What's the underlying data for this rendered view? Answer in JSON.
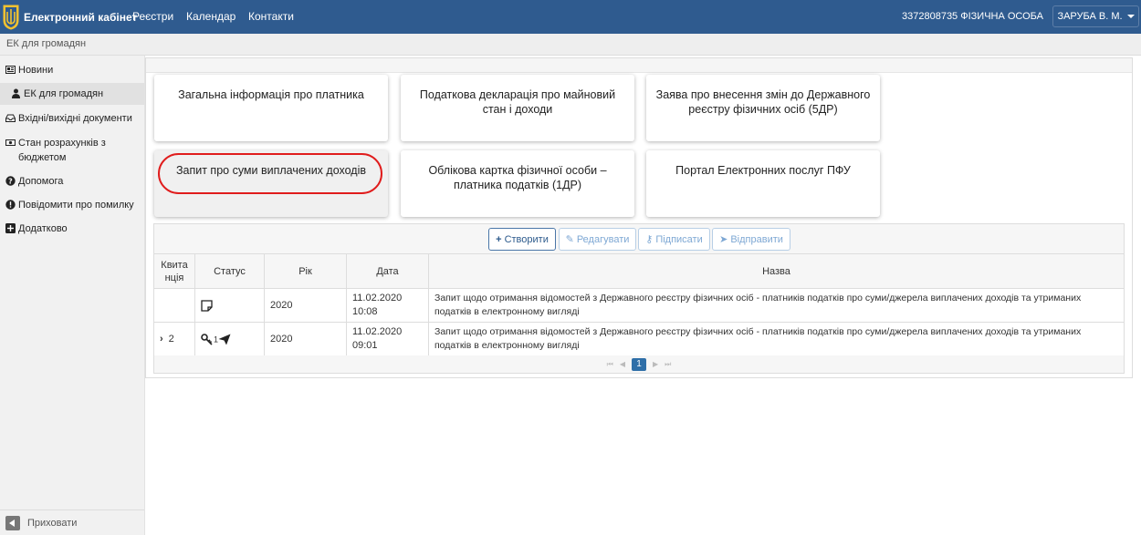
{
  "navbar": {
    "brand": "Електронний кабінет",
    "links": [
      "Реєстри",
      "Календар",
      "Контакти"
    ],
    "user_id": "3372808735 ФІЗИЧНА ОСОБА",
    "user_name": "ЗАРУБА В. М."
  },
  "breadcrumb": "ЕК для громадян",
  "sidebar": {
    "items": [
      {
        "label": "Новини",
        "icon": "newspaper-icon"
      },
      {
        "label": "ЕК для громадян",
        "icon": "user-icon"
      },
      {
        "label": "Вхідні/вихідні документи",
        "icon": "inbox-icon"
      },
      {
        "label": "Стан розрахунків з бюджетом",
        "icon": "money-icon"
      },
      {
        "label": "Допомога",
        "icon": "question-icon"
      },
      {
        "label": "Повідомити про помилку",
        "icon": "exclamation-icon"
      },
      {
        "label": "Додатково",
        "icon": "plus-square-icon"
      }
    ],
    "hide_label": "Приховати"
  },
  "cards": [
    "Загальна інформація про платника",
    "Податкова декларація про майновий стан і доходи",
    "Заява про внесення змін до Державного реєстру фізичних осіб (5ДР)",
    "Запит про суми виплачених доходів",
    "Облікова картка фізичної особи – платника податків (1ДР)",
    "Портал Електронних послуг ПФУ"
  ],
  "toolbar": {
    "create": "Створити",
    "edit": "Редагувати",
    "sign": "Підписати",
    "send": "Відправити"
  },
  "table": {
    "headers": {
      "receipt_line1": "Квита",
      "receipt_line2": "нція",
      "status": "Статус",
      "year": "Рік",
      "date": "Дата",
      "name": "Назва"
    },
    "rows": [
      {
        "receipt": "",
        "status_count": "",
        "year": "2020",
        "date_line1": "11.02.2020",
        "date_line2": "10:08",
        "name": "Запит щодо отримання відомостей з Державного реєстру фізичних осіб - платників податків про суми/джерела виплачених доходів та утриманих податків в електронному вигляді"
      },
      {
        "receipt": "2",
        "status_count": "1",
        "year": "2020",
        "date_line1": "11.02.2020",
        "date_line2": "09:01",
        "name": "Запит щодо отримання відомостей з Державного реєстру фізичних осіб - платників податків про суми/джерела виплачених доходів та утриманих податків в електронному вигляді"
      }
    ]
  },
  "pager": {
    "current": "1"
  },
  "colors": {
    "navbar": "#2f5b8f",
    "highlight": "#e01c1c",
    "accent": "#2f6fa8"
  }
}
